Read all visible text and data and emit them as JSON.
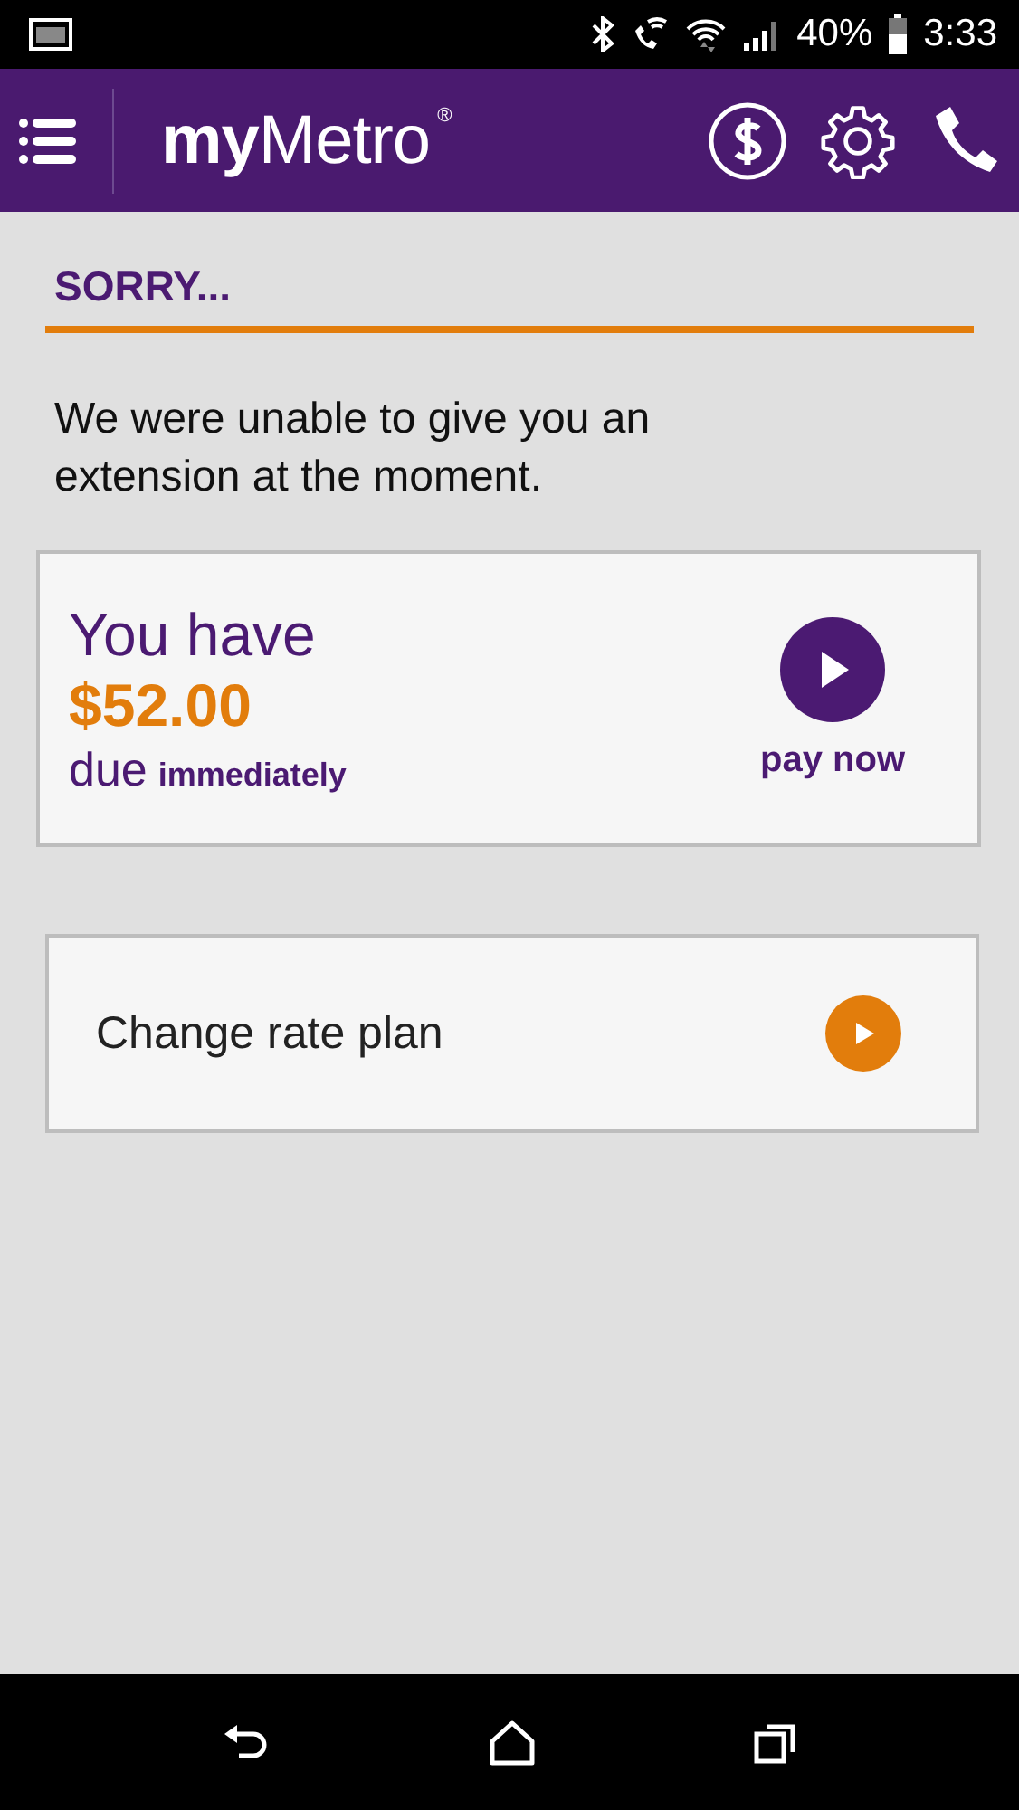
{
  "status_bar": {
    "battery": "40%",
    "time": "3:33"
  },
  "header": {
    "logo": "**my**Metro",
    "logo_mark": "®"
  },
  "heading": "SORRY...",
  "message": "We were unable to give you an extension at the moment.",
  "balance_card": {
    "title": "You have",
    "amount": "$52.00",
    "due": "due",
    "due_note": "immediately",
    "action": "pay now"
  },
  "links": [
    {
      "label": "Change rate plan"
    }
  ]
}
